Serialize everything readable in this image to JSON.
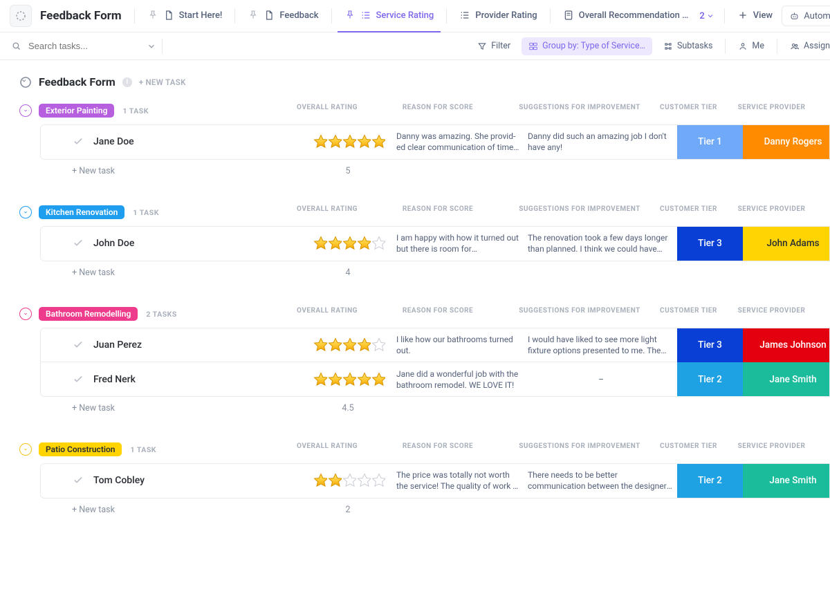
{
  "app": {
    "title": "Feedback Form"
  },
  "tabs": {
    "start": "Start Here!",
    "feedback": "Feedback",
    "service": "Service Rating",
    "provider": "Provider Rating",
    "overall": "Overall Recommendation …",
    "more_count": "2",
    "view": "View",
    "automate": "Automate"
  },
  "toolbar": {
    "search_placeholder": "Search tasks...",
    "filter": "Filter",
    "group": "Group by: Type of Service…",
    "subtasks": "Subtasks",
    "me": "Me",
    "assign": "Assign"
  },
  "section": {
    "title": "Feedback Form",
    "new_task": "+ NEW TASK"
  },
  "columns": {
    "overall": "OVERALL RATING",
    "reason": "REASON FOR SCORE",
    "suggestions": "SUGGESTIONS FOR IMPROVEMENT",
    "tier": "CUSTOMER TIER",
    "provider": "SERVICE PROVIDER"
  },
  "new_task_row": "+ New task",
  "groups": [
    {
      "name": "Exterior Painting",
      "count": "1 TASK",
      "pill_color": "#b660e0",
      "ring_color": "#b660e0",
      "avg": "5",
      "rows": [
        {
          "name": "Jane Doe",
          "stars": 5,
          "reason": "Danny was amazing. She provid­ed clear communication of time…",
          "suggestions": "Danny did such an amazing job I don't have any!",
          "tier": "Tier 1",
          "tier_bg": "#6fa9f7",
          "provider": "Danny Rogers",
          "prov_bg": "#ff8b00"
        }
      ]
    },
    {
      "name": "Kitchen Renovation",
      "count": "1 TASK",
      "pill_color": "#1f9ef0",
      "ring_color": "#1f9ef0",
      "avg": "4",
      "rows": [
        {
          "name": "John Doe",
          "stars": 4,
          "reason": "I am happy with how it turned out but there is room for improvement",
          "suggestions": "The renovation took a few days longer than planned. I think we could have finished on …",
          "tier": "Tier 3",
          "tier_bg": "#0a3fd6",
          "provider": "John Adams",
          "prov_bg": "#ffd400",
          "prov_fg": "#2a2e34"
        }
      ]
    },
    {
      "name": "Bathroom Remodelling",
      "count": "2 TASKS",
      "pill_color": "#ee3b8c",
      "ring_color": "#ee3b8c",
      "avg": "4.5",
      "rows": [
        {
          "name": "Juan Perez",
          "stars": 4,
          "reason": "I like how our bathrooms turned out.",
          "suggestions": "I would have liked to see more light fixture op­tions presented to me. The options provided…",
          "tier": "Tier 3",
          "tier_bg": "#0a3fd6",
          "provider": "James Johnson",
          "prov_bg": "#e3000f"
        },
        {
          "name": "Fred Nerk",
          "stars": 5,
          "reason": "Jane did a wonderful job with the bathroom remodel. WE LOVE IT!",
          "suggestions": "–",
          "tier": "Tier 2",
          "tier_bg": "#1ea2e3",
          "provider": "Jane Smith",
          "prov_bg": "#1abc9c"
        }
      ]
    },
    {
      "name": "Patio Construction",
      "count": "1 TASK",
      "pill_color": "#ffd400",
      "pill_fg": "#2a2e34",
      "ring_color": "#f5c518",
      "avg": "2",
      "rows": [
        {
          "name": "Tom Cobley",
          "stars": 2,
          "reason": "The price was totally not worth the service! The quality of work …",
          "suggestions": "There needs to be better communication be­tween the designer and the people doing the…",
          "tier": "Tier 2",
          "tier_bg": "#1ea2e3",
          "provider": "Jane Smith",
          "prov_bg": "#1abc9c"
        }
      ]
    }
  ]
}
